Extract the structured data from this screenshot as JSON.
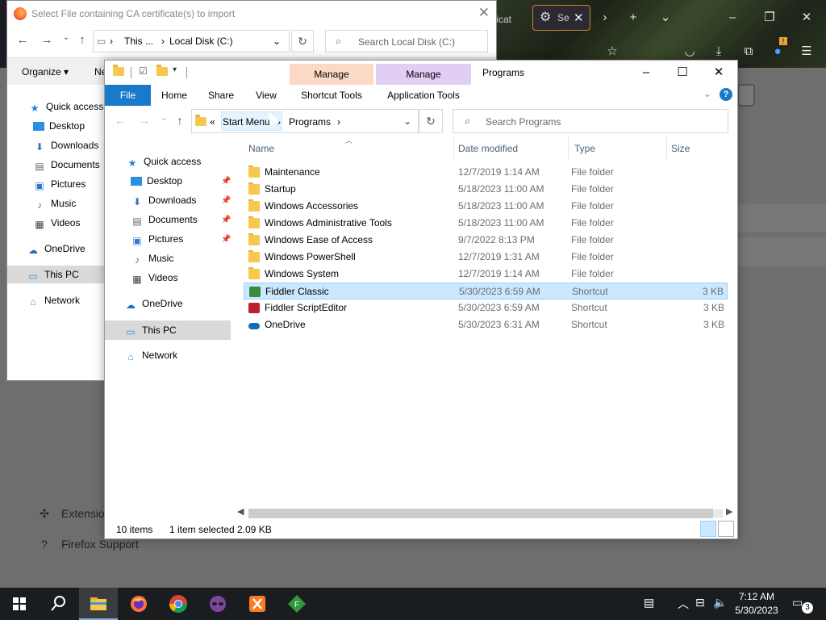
{
  "firefox": {
    "tab_partial_label": "ficat",
    "active_tab_label": "Se",
    "page_links": [
      {
        "label": "Extensio",
        "icon": "puzzle-icon"
      },
      {
        "label": "Firefox Support",
        "icon": "help-circle-icon"
      }
    ],
    "notification_badge": "!"
  },
  "back_dialog": {
    "title": "Select File containing CA certificate(s) to import",
    "address": {
      "prefix": "This ...",
      "location": "Local Disk (C:)"
    },
    "search_placeholder": "Search Local Disk (C:)",
    "organize_label": "Organize ▾",
    "new_label_partial": "Ne",
    "nav_items": [
      {
        "label": "Quick access",
        "icon": "star-icon"
      },
      {
        "label": "Desktop",
        "icon": "desktop-icon"
      },
      {
        "label": "Downloads",
        "icon": "download-icon"
      },
      {
        "label": "Documents",
        "icon": "document-icon"
      },
      {
        "label": "Pictures",
        "icon": "picture-icon"
      },
      {
        "label": "Music",
        "icon": "music-icon"
      },
      {
        "label": "Videos",
        "icon": "video-icon"
      },
      {
        "label": "OneDrive",
        "icon": "cloud-icon"
      },
      {
        "label": "This PC",
        "icon": "pc-icon"
      },
      {
        "label": "Network",
        "icon": "network-icon"
      }
    ]
  },
  "explorer": {
    "title": "Programs",
    "context_tabs": [
      {
        "group": "Manage",
        "tool": "Shortcut Tools",
        "color": "#fcd9c4"
      },
      {
        "group": "Manage",
        "tool": "Application Tools",
        "color": "#e2cdf5"
      }
    ],
    "ribbon_tabs": [
      "File",
      "Home",
      "Share",
      "View"
    ],
    "breadcrumb": {
      "overflow": "«",
      "items": [
        "Start Menu",
        "Programs"
      ]
    },
    "search_placeholder": "Search Programs",
    "nav": [
      {
        "label": "Quick access",
        "icon": "star-icon",
        "pinned": false
      },
      {
        "label": "Desktop",
        "icon": "desktop-icon",
        "pinned": true
      },
      {
        "label": "Downloads",
        "icon": "download-icon",
        "pinned": true
      },
      {
        "label": "Documents",
        "icon": "document-icon",
        "pinned": true
      },
      {
        "label": "Pictures",
        "icon": "picture-icon",
        "pinned": true
      },
      {
        "label": "Music",
        "icon": "music-icon",
        "pinned": false
      },
      {
        "label": "Videos",
        "icon": "video-icon",
        "pinned": false
      },
      {
        "label": "OneDrive",
        "icon": "cloud-icon",
        "pinned": false
      },
      {
        "label": "This PC",
        "icon": "pc-icon",
        "pinned": false
      },
      {
        "label": "Network",
        "icon": "network-icon",
        "pinned": false
      }
    ],
    "columns": [
      "Name",
      "Date modified",
      "Type",
      "Size"
    ],
    "files": [
      {
        "name": "Maintenance",
        "date": "12/7/2019 1:14 AM",
        "type": "File folder",
        "size": "",
        "icon": "folder-icon"
      },
      {
        "name": "Startup",
        "date": "5/18/2023 11:00 AM",
        "type": "File folder",
        "size": "",
        "icon": "folder-icon"
      },
      {
        "name": "Windows Accessories",
        "date": "5/18/2023 11:00 AM",
        "type": "File folder",
        "size": "",
        "icon": "folder-icon"
      },
      {
        "name": "Windows Administrative Tools",
        "date": "5/18/2023 11:00 AM",
        "type": "File folder",
        "size": "",
        "icon": "folder-icon"
      },
      {
        "name": "Windows Ease of Access",
        "date": "9/7/2022 8:13 PM",
        "type": "File folder",
        "size": "",
        "icon": "folder-icon"
      },
      {
        "name": "Windows PowerShell",
        "date": "12/7/2019 1:31 AM",
        "type": "File folder",
        "size": "",
        "icon": "folder-icon"
      },
      {
        "name": "Windows System",
        "date": "12/7/2019 1:14 AM",
        "type": "File folder",
        "size": "",
        "icon": "folder-icon"
      },
      {
        "name": "Fiddler Classic",
        "date": "5/30/2023 6:59 AM",
        "type": "Shortcut",
        "size": "3 KB",
        "icon": "fiddler-icon",
        "selected": true
      },
      {
        "name": "Fiddler ScriptEditor",
        "date": "5/30/2023 6:59 AM",
        "type": "Shortcut",
        "size": "3 KB",
        "icon": "fiddler-script-icon"
      },
      {
        "name": "OneDrive",
        "date": "5/30/2023 6:31 AM",
        "type": "Shortcut",
        "size": "3 KB",
        "icon": "onedrive-icon"
      }
    ],
    "status": {
      "count": "10 items",
      "selection": "1 item selected",
      "size": "2.09 KB"
    }
  },
  "taskbar": {
    "apps": [
      "start-icon",
      "search-icon",
      "file-explorer-icon",
      "firefox-icon",
      "chrome-icon",
      "tor-icon",
      "xampp-icon",
      "fiddler-icon"
    ],
    "time": "7:12 AM",
    "date": "5/30/2023",
    "notification_count": "3"
  }
}
